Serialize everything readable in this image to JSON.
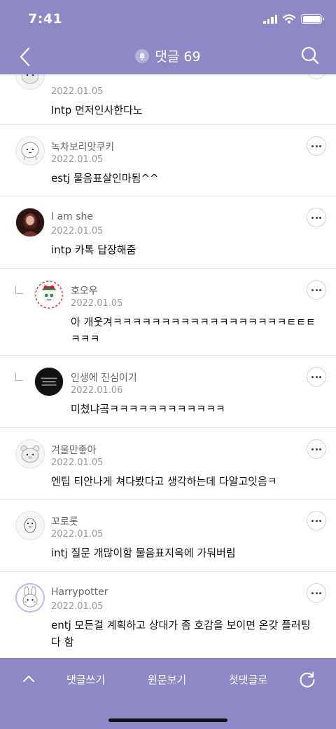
{
  "status": {
    "time": "7:41"
  },
  "header": {
    "title": "댓글 69",
    "icons": [
      "back-chevron-icon",
      "bell-icon",
      "search-icon"
    ]
  },
  "comments": [
    {
      "name": "",
      "date": "2022.01.05",
      "body": "Intp 먼저인사한다노",
      "avatar": "cartoon-ghost"
    },
    {
      "name": "녹차보리맛쿠키",
      "date": "2022.01.05",
      "body": "estj 물음표살인마됨^^",
      "avatar": "cartoon-face"
    },
    {
      "name": "I am she",
      "date": "2022.01.05",
      "body": "intp 카톡 답장해줌",
      "avatar": "photo-woman"
    },
    {
      "name": "호오우",
      "date": "2022.01.05",
      "body": "아 개웃겨ㅋㅋㅋㅋㅋㅋㅋㅋㅋㅋㅋㅋㅋㅋㅋㅋㅋㅋㅌㅌㅌㅋㅋㅋ",
      "reply": true,
      "avatar": "christmas-character"
    },
    {
      "name": "인생에 진심이기",
      "date": "2022.01.06",
      "body": "미쳤냐곸ㅋㅋㅋㅋㅋㅋㅋㅋㅋㅋㅋㅋ",
      "reply": true,
      "avatar": "black-sign"
    },
    {
      "name": "겨울만좋아",
      "date": "2022.01.05",
      "body": "엔팁 티안나게 쳐다봤다고 생각하는데 다알고잇음ㅋ",
      "avatar": "cartoon-bear"
    },
    {
      "name": "꼬로롯",
      "date": "2022.01.05",
      "body": "intj 질문 개많이함 물음표지옥에 가둬버림",
      "avatar": "cartoon-bird"
    },
    {
      "name": "Harrypotter",
      "date": "2022.01.05",
      "body": "entj 모든걸 계획하고 상대가 좀 호감을 보이면 온갖 플러팅 다 함",
      "avatar": "rainbow-bunny"
    }
  ],
  "bottom_bar": {
    "write_label": "댓글쓰기",
    "original_label": "원문보기",
    "first_label": "첫댓글로",
    "icons": [
      "chevron-up-icon",
      "refresh-icon"
    ]
  },
  "colors": {
    "theme": "#8f88c7",
    "text": "#111111",
    "meta": "#9a9a9a"
  }
}
